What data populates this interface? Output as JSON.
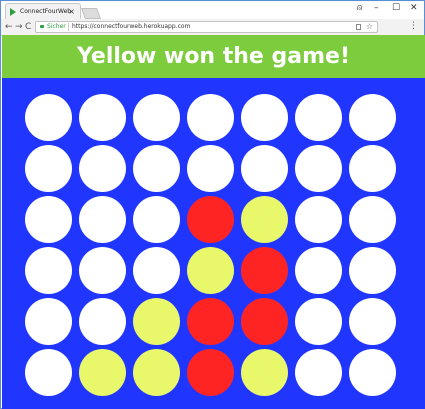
{
  "browser": {
    "tab_title": "ConnectFourWeb",
    "tab_close": "×",
    "security_label": "Sicher",
    "url": "https://connectfourweb.herokuapp.com",
    "window_controls": {
      "profile": "⍝",
      "minimize": "–",
      "maximize": "☐",
      "close": "✕"
    },
    "nav": {
      "back": "←",
      "forward": "→",
      "reload": "C"
    },
    "star": "☆",
    "menu": "⋮"
  },
  "game": {
    "status_message": "Yellow won the game!",
    "colors": {
      "header": "#7ccc3e",
      "board": "#2036ff",
      "empty": "#ffffff",
      "red": "#ff2424",
      "yellow": "#e9f76a"
    },
    "board": [
      [
        "empty",
        "empty",
        "empty",
        "empty",
        "empty",
        "empty",
        "empty"
      ],
      [
        "empty",
        "empty",
        "empty",
        "empty",
        "empty",
        "empty",
        "empty"
      ],
      [
        "empty",
        "empty",
        "empty",
        "red",
        "yellow",
        "empty",
        "empty"
      ],
      [
        "empty",
        "empty",
        "empty",
        "yellow",
        "red",
        "empty",
        "empty"
      ],
      [
        "empty",
        "empty",
        "yellow",
        "red",
        "red",
        "empty",
        "empty"
      ],
      [
        "empty",
        "yellow",
        "yellow",
        "red",
        "yellow",
        "empty",
        "empty"
      ]
    ]
  }
}
